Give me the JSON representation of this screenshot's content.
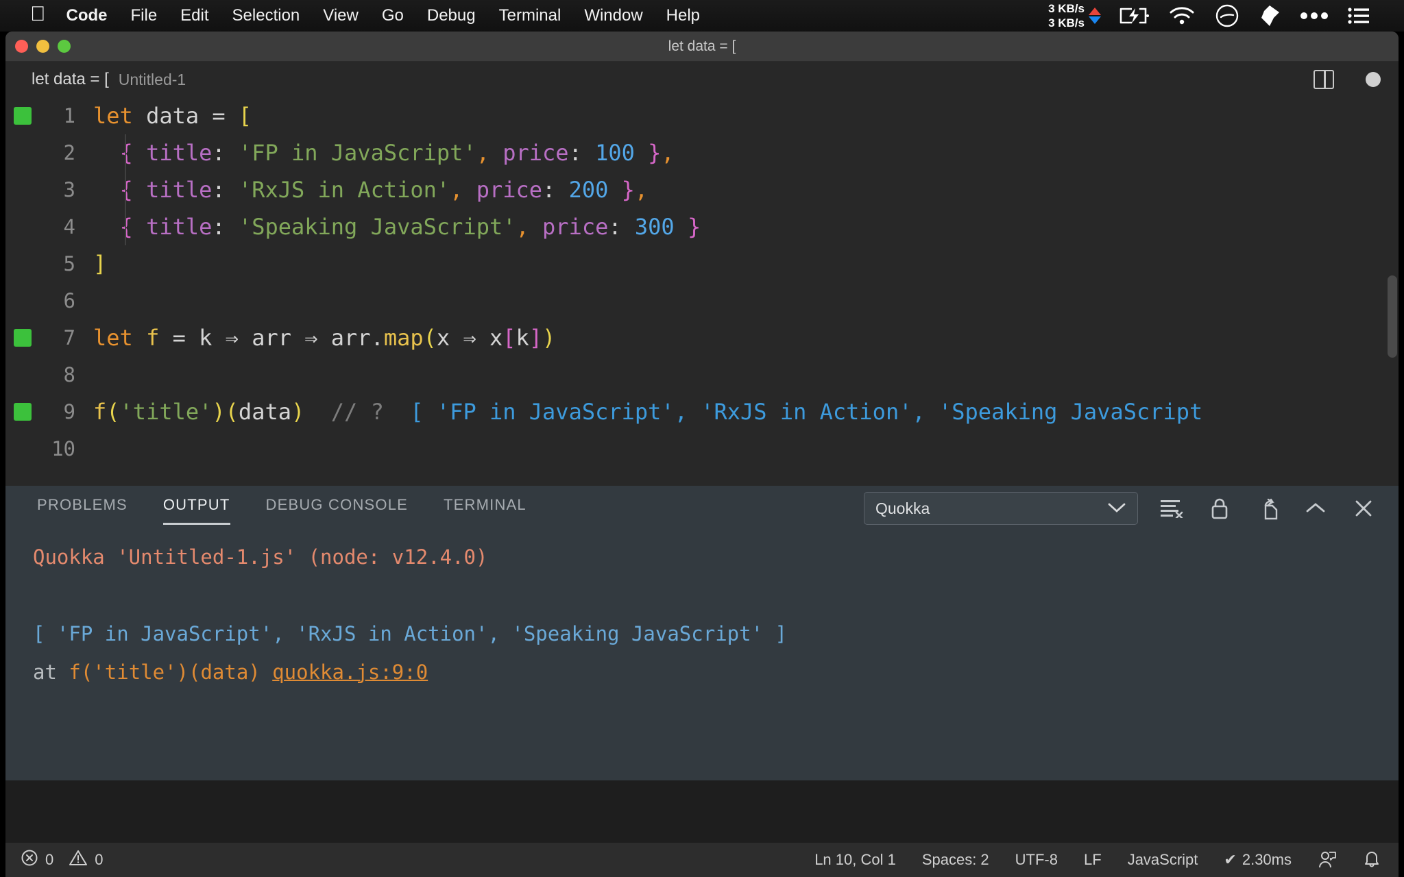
{
  "menubar": {
    "apple_icon": "apple-icon",
    "items": [
      {
        "label": "Code",
        "bold": true
      },
      {
        "label": "File",
        "bold": false
      },
      {
        "label": "Edit",
        "bold": false
      },
      {
        "label": "Selection",
        "bold": false
      },
      {
        "label": "View",
        "bold": false
      },
      {
        "label": "Go",
        "bold": false
      },
      {
        "label": "Debug",
        "bold": false
      },
      {
        "label": "Terminal",
        "bold": false
      },
      {
        "label": "Window",
        "bold": false
      },
      {
        "label": "Help",
        "bold": false
      }
    ],
    "network": {
      "upload": "3 KB/s",
      "download": "3 KB/s",
      "up_color": "#e8453c",
      "down_color": "#1a86f0"
    },
    "status_icons": [
      "battery-charging-icon",
      "wifi-icon",
      "time-machine-icon",
      "dropbox-icon",
      "more-icon",
      "control-center-icon"
    ]
  },
  "window": {
    "title": "let data = [",
    "traffic_lights": [
      "close-button",
      "minimize-button",
      "zoom-button"
    ]
  },
  "breadcrumb": {
    "main": "let data = [",
    "sub": "Untitled-1",
    "actions": [
      "split-editor-icon",
      "unsaved-dot-icon"
    ]
  },
  "editor": {
    "lines": [
      {
        "n": "1",
        "marker": true,
        "guide": false,
        "tokens": [
          {
            "t": "let",
            "c": "t-kw"
          },
          {
            "t": " ",
            "c": "t-var"
          },
          {
            "t": "data",
            "c": "t-var"
          },
          {
            "t": " ",
            "c": "t-var"
          },
          {
            "t": "=",
            "c": "t-op"
          },
          {
            "t": " ",
            "c": "t-var"
          },
          {
            "t": "[",
            "c": "t-brk1"
          }
        ]
      },
      {
        "n": "2",
        "marker": false,
        "guide": true,
        "tokens": [
          {
            "t": "  ",
            "c": "t-var"
          },
          {
            "t": "{",
            "c": "t-brk2"
          },
          {
            "t": " ",
            "c": "t-var"
          },
          {
            "t": "title",
            "c": "t-prop"
          },
          {
            "t": ":",
            "c": "t-var"
          },
          {
            "t": " ",
            "c": "t-var"
          },
          {
            "t": "'FP in JavaScript'",
            "c": "t-str"
          },
          {
            "t": ",",
            "c": "t-punc"
          },
          {
            "t": " ",
            "c": "t-var"
          },
          {
            "t": "price",
            "c": "t-prop"
          },
          {
            "t": ":",
            "c": "t-var"
          },
          {
            "t": " ",
            "c": "t-var"
          },
          {
            "t": "100",
            "c": "t-num"
          },
          {
            "t": " ",
            "c": "t-var"
          },
          {
            "t": "}",
            "c": "t-brk2"
          },
          {
            "t": ",",
            "c": "t-punc"
          }
        ]
      },
      {
        "n": "3",
        "marker": false,
        "guide": true,
        "tokens": [
          {
            "t": "  ",
            "c": "t-var"
          },
          {
            "t": "{",
            "c": "t-brk2"
          },
          {
            "t": " ",
            "c": "t-var"
          },
          {
            "t": "title",
            "c": "t-prop"
          },
          {
            "t": ":",
            "c": "t-var"
          },
          {
            "t": " ",
            "c": "t-var"
          },
          {
            "t": "'RxJS in Action'",
            "c": "t-str"
          },
          {
            "t": ",",
            "c": "t-punc"
          },
          {
            "t": " ",
            "c": "t-var"
          },
          {
            "t": "price",
            "c": "t-prop"
          },
          {
            "t": ":",
            "c": "t-var"
          },
          {
            "t": " ",
            "c": "t-var"
          },
          {
            "t": "200",
            "c": "t-num"
          },
          {
            "t": " ",
            "c": "t-var"
          },
          {
            "t": "}",
            "c": "t-brk2"
          },
          {
            "t": ",",
            "c": "t-punc"
          }
        ]
      },
      {
        "n": "4",
        "marker": false,
        "guide": true,
        "tokens": [
          {
            "t": "  ",
            "c": "t-var"
          },
          {
            "t": "{",
            "c": "t-brk2"
          },
          {
            "t": " ",
            "c": "t-var"
          },
          {
            "t": "title",
            "c": "t-prop"
          },
          {
            "t": ":",
            "c": "t-var"
          },
          {
            "t": " ",
            "c": "t-var"
          },
          {
            "t": "'Speaking JavaScript'",
            "c": "t-str"
          },
          {
            "t": ",",
            "c": "t-punc"
          },
          {
            "t": " ",
            "c": "t-var"
          },
          {
            "t": "price",
            "c": "t-prop"
          },
          {
            "t": ":",
            "c": "t-var"
          },
          {
            "t": " ",
            "c": "t-var"
          },
          {
            "t": "300",
            "c": "t-num"
          },
          {
            "t": " ",
            "c": "t-var"
          },
          {
            "t": "}",
            "c": "t-brk2"
          }
        ]
      },
      {
        "n": "5",
        "marker": false,
        "guide": false,
        "tokens": [
          {
            "t": "]",
            "c": "t-brk1"
          }
        ]
      },
      {
        "n": "6",
        "marker": false,
        "guide": false,
        "tokens": []
      },
      {
        "n": "7",
        "marker": true,
        "guide": false,
        "tokens": [
          {
            "t": "let",
            "c": "t-kw"
          },
          {
            "t": " ",
            "c": "t-var"
          },
          {
            "t": "f",
            "c": "t-fn"
          },
          {
            "t": " ",
            "c": "t-var"
          },
          {
            "t": "=",
            "c": "t-op"
          },
          {
            "t": " ",
            "c": "t-var"
          },
          {
            "t": "k",
            "c": "t-var"
          },
          {
            "t": " ",
            "c": "t-var"
          },
          {
            "t": "⇒",
            "c": "t-var"
          },
          {
            "t": " ",
            "c": "t-var"
          },
          {
            "t": "arr",
            "c": "t-var"
          },
          {
            "t": " ",
            "c": "t-var"
          },
          {
            "t": "⇒",
            "c": "t-var"
          },
          {
            "t": " ",
            "c": "t-var"
          },
          {
            "t": "arr",
            "c": "t-var"
          },
          {
            "t": ".",
            "c": "t-var"
          },
          {
            "t": "map",
            "c": "t-fn"
          },
          {
            "t": "(",
            "c": "t-brk1"
          },
          {
            "t": "x",
            "c": "t-var"
          },
          {
            "t": " ",
            "c": "t-var"
          },
          {
            "t": "⇒",
            "c": "t-var"
          },
          {
            "t": " ",
            "c": "t-var"
          },
          {
            "t": "x",
            "c": "t-var"
          },
          {
            "t": "[",
            "c": "t-brk2"
          },
          {
            "t": "k",
            "c": "t-var"
          },
          {
            "t": "]",
            "c": "t-brk2"
          },
          {
            "t": ")",
            "c": "t-brk1"
          }
        ]
      },
      {
        "n": "8",
        "marker": false,
        "guide": false,
        "tokens": []
      },
      {
        "n": "9",
        "marker": true,
        "guide": false,
        "tokens": [
          {
            "t": "f",
            "c": "t-fn"
          },
          {
            "t": "(",
            "c": "t-brk1"
          },
          {
            "t": "'title'",
            "c": "t-str"
          },
          {
            "t": ")",
            "c": "t-brk1"
          },
          {
            "t": "(",
            "c": "t-brk1"
          },
          {
            "t": "data",
            "c": "t-var"
          },
          {
            "t": ")",
            "c": "t-brk1"
          },
          {
            "t": "  ",
            "c": "t-var"
          },
          {
            "t": "// ?",
            "c": "t-cmt"
          },
          {
            "t": "  ",
            "c": "t-var"
          },
          {
            "t": "[ 'FP in JavaScript', 'RxJS in Action', 'Speaking JavaScript",
            "c": "t-quokka"
          }
        ]
      },
      {
        "n": "10",
        "marker": false,
        "guide": false,
        "tokens": []
      }
    ]
  },
  "panel": {
    "tabs": [
      {
        "label": "PROBLEMS",
        "active": false
      },
      {
        "label": "OUTPUT",
        "active": true
      },
      {
        "label": "DEBUG CONSOLE",
        "active": false
      },
      {
        "label": "TERMINAL",
        "active": false
      }
    ],
    "channel": "Quokka",
    "actions": [
      "clear-output-icon",
      "lock-scroll-icon",
      "open-in-editor-icon",
      "maximize-panel-icon",
      "close-panel-icon"
    ],
    "output": {
      "header": "Quokka 'Untitled-1.js' (node: v12.4.0)",
      "result": "[ 'FP in JavaScript', 'RxJS in Action', 'Speaking JavaScript' ]",
      "trace_at": "at ",
      "trace_call": "f('title')(data) ",
      "trace_link": "quokka.js:9:0"
    }
  },
  "statusbar": {
    "errors": "0",
    "warnings": "0",
    "position": "Ln 10, Col 1",
    "indentation": "Spaces: 2",
    "encoding": "UTF-8",
    "eol": "LF",
    "language": "JavaScript",
    "quokka_time": "2.30ms",
    "quokka_check": "✔",
    "right_icons": [
      "feedback-icon",
      "notifications-bell-icon"
    ]
  },
  "colors": {
    "accent_green": "#3cc13c",
    "quokka_blue": "#3d9bdd",
    "output_salmon": "#e58a6e",
    "link_orange": "#e08b34"
  }
}
